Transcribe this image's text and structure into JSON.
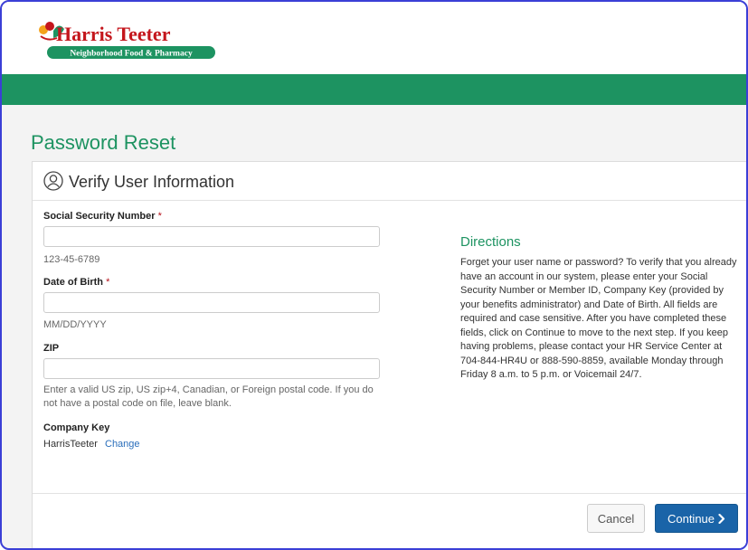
{
  "brand": {
    "name": "Harris Teeter",
    "tagline": "Neighborhood Food & Pharmacy",
    "colors": {
      "green": "#1d9361",
      "red": "#c4161c",
      "blue": "#1a64a8"
    }
  },
  "page": {
    "title": "Password Reset"
  },
  "card": {
    "title": "Verify User Information",
    "icon": "user-icon"
  },
  "form": {
    "ssn": {
      "label": "Social Security Number",
      "required_mark": "*",
      "value": "",
      "hint": "123-45-6789"
    },
    "dob": {
      "label": "Date of Birth",
      "required_mark": "*",
      "value": "",
      "hint": "MM/DD/YYYY"
    },
    "zip": {
      "label": "ZIP",
      "value": "",
      "hint": "Enter a valid US zip, US zip+4, Canadian, or Foreign postal code. If you do not have a postal code on file, leave blank."
    },
    "company_key": {
      "label": "Company Key",
      "value": "HarrisTeeter",
      "change_label": "Change"
    }
  },
  "directions": {
    "title": "Directions",
    "text": "Forget your user name or password? To verify that you already have an account in our system, please enter your Social Security Number or Member ID, Company Key (provided by your benefits administrator) and Date of Birth. All fields are required and case sensitive. After you have completed these fields, click on Continue to move to the next step. If you keep having problems, please contact your HR Service Center at 704-844-HR4U or 888-590-8859, available Monday through Friday 8 a.m. to 5 p.m. or Voicemail 24/7."
  },
  "actions": {
    "cancel_label": "Cancel",
    "continue_label": "Continue",
    "continue_icon": "chevron-right-icon"
  }
}
